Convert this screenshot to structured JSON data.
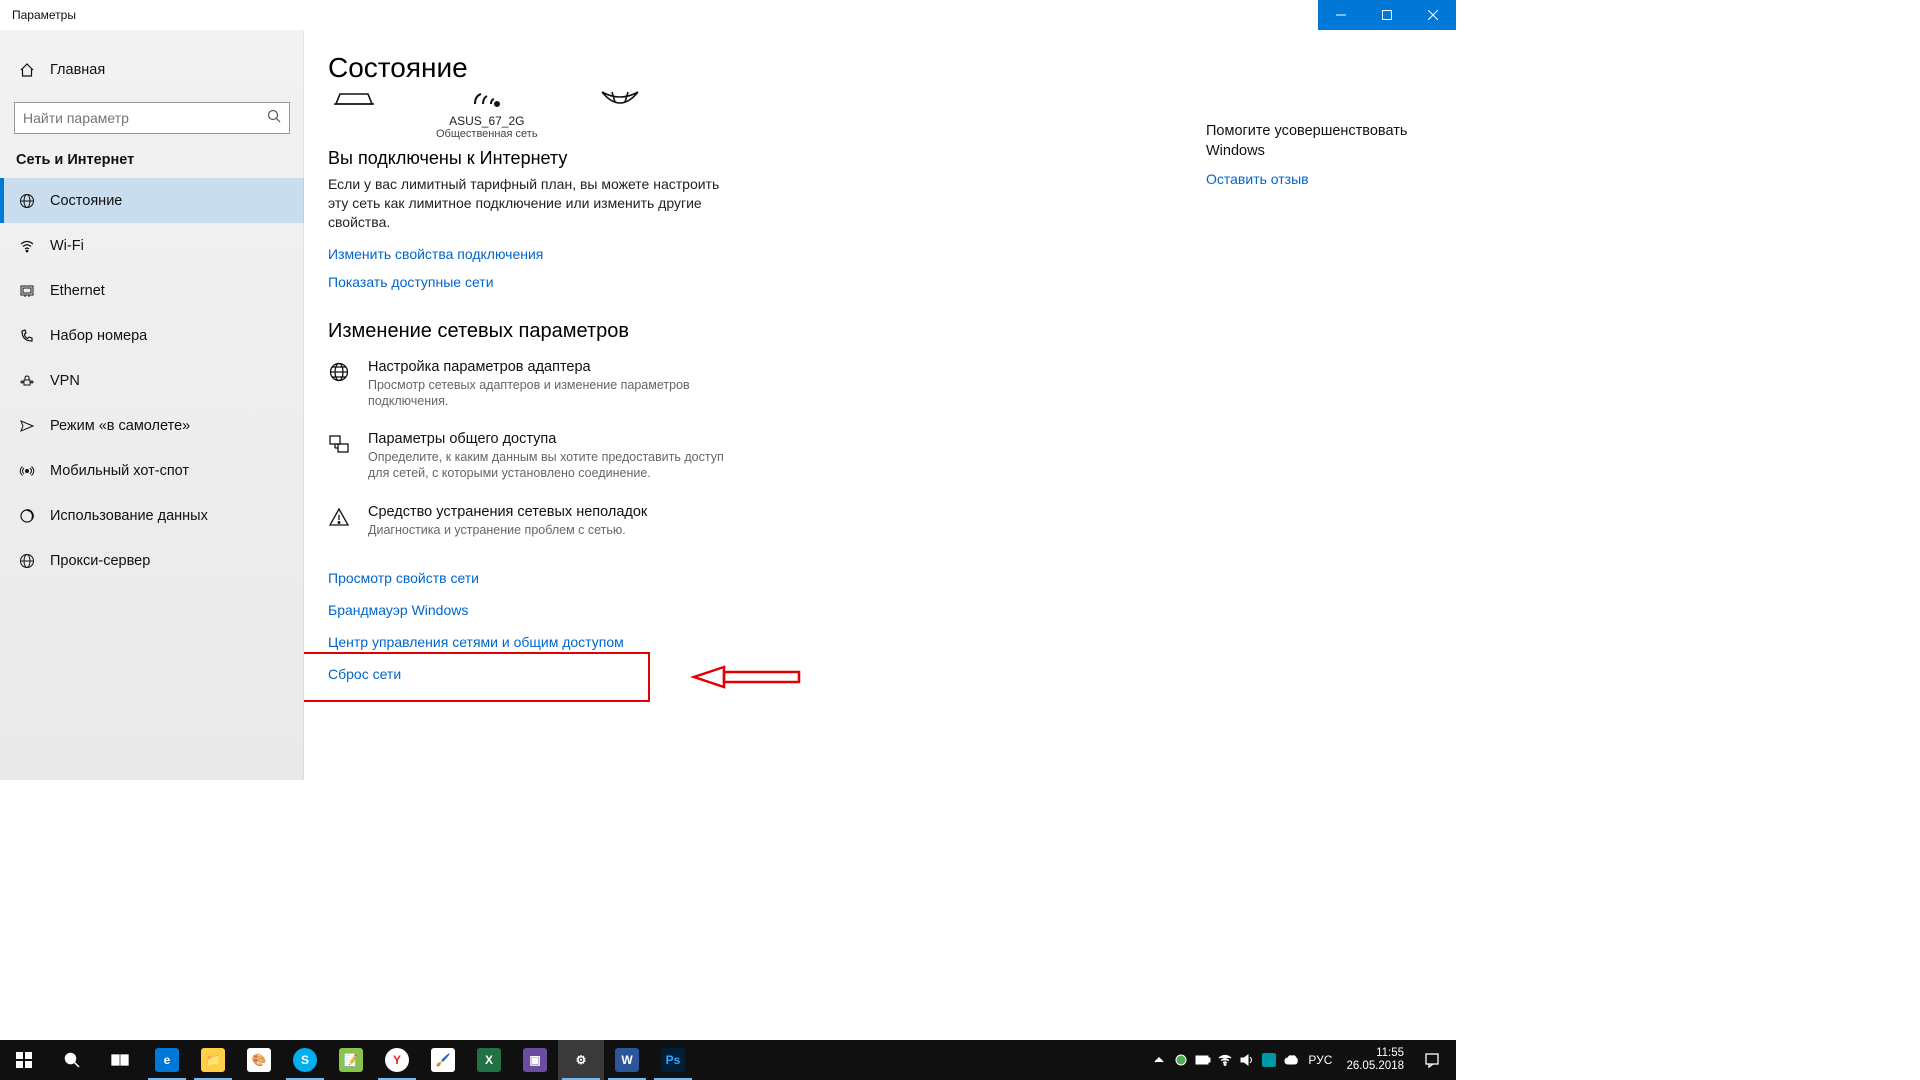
{
  "titlebar": {
    "title": "Параметры"
  },
  "sidebar": {
    "home": "Главная",
    "search_placeholder": "Найти параметр",
    "section": "Сеть и Интернет",
    "items": [
      {
        "label": "Состояние"
      },
      {
        "label": "Wi-Fi"
      },
      {
        "label": "Ethernet"
      },
      {
        "label": "Набор номера"
      },
      {
        "label": "VPN"
      },
      {
        "label": "Режим «в самолете»"
      },
      {
        "label": "Мобильный хот-спот"
      },
      {
        "label": "Использование данных"
      },
      {
        "label": "Прокси-сервер"
      }
    ]
  },
  "main": {
    "title": "Состояние",
    "network": {
      "name": "ASUS_67_2G",
      "type": "Общественная сеть"
    },
    "connected_heading": "Вы подключены к Интернету",
    "connected_text": "Если у вас лимитный тарифный план, вы можете настроить эту сеть как лимитное подключение или изменить другие свойства.",
    "link_change_props": "Изменить свойства подключения",
    "link_show_nets": "Показать доступные сети",
    "change_heading": "Изменение сетевых параметров",
    "opts": [
      {
        "title": "Настройка параметров адаптера",
        "desc": "Просмотр сетевых адаптеров и изменение параметров подключения."
      },
      {
        "title": "Параметры общего доступа",
        "desc": "Определите, к каким данным вы хотите предоставить доступ для сетей, с которыми установлено соединение."
      },
      {
        "title": "Средство устранения сетевых неполадок",
        "desc": "Диагностика и устранение проблем с сетью."
      }
    ],
    "links": [
      "Просмотр свойств сети",
      "Брандмауэр Windows",
      "Центр управления сетями и общим доступом",
      "Сброс сети"
    ]
  },
  "help": {
    "title": "Помогите усовершенствовать Windows",
    "link": "Оставить отзыв"
  },
  "taskbar": {
    "lang": "РУС",
    "time": "11:55",
    "date": "26.05.2018"
  }
}
